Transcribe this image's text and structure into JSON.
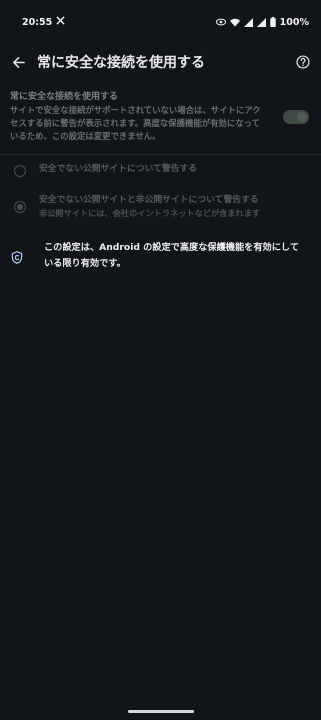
{
  "status_bar": {
    "time": "20:55",
    "battery": "100%"
  },
  "app_bar": {
    "title": "常に安全な接続を使用する"
  },
  "setting": {
    "title": "常に安全な接続を使用する",
    "description_lines": [
      "サイトで安全な接続がサポートされていない場合は、サイトにアク",
      "セスする前に警告が表示されます。高度な保護機能が有効になって",
      "いるため、この設定は変更できません。"
    ],
    "toggle_on": true
  },
  "options": [
    {
      "label": "安全でない公開サイトについて警告する",
      "sublabel": "",
      "checked": false
    },
    {
      "label": "安全でない公開サイトと非公開サイトについて警告する",
      "sublabel": "非公開サイトには、会社のイントラネットなどが含まれます",
      "checked": true
    }
  ],
  "managed_notice": {
    "lines": [
      "この設定は、Android の設定で高度な保護機能を有効にして",
      "いる限り有効です。"
    ]
  },
  "colors": {
    "background": "#111419",
    "text": "#e3e3e6",
    "disabled_text": "#55585e"
  }
}
